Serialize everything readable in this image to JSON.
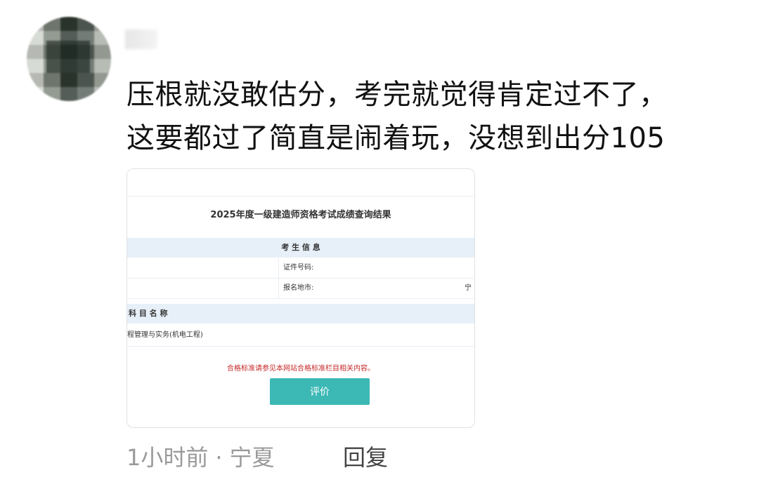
{
  "comment": {
    "line1": "压根就没敢估分，考完就觉得肯定过不了，",
    "line2": "这要都过了简直是闹着玩，没想到出分105"
  },
  "card": {
    "title": "2025年度一级建造师资格考试成绩查询结果",
    "section_title": "考  生  信  息",
    "id_label": "证件号码:",
    "region_label": "报名地市:",
    "region_value": "宁",
    "subject_header": "科  目  名  称",
    "subject_name": "程管理与实务(机电工程)",
    "notice": "合格标准请参见本网站合格标准栏目相关内容。",
    "button_label": "评价"
  },
  "meta": {
    "time": "1小时前",
    "separator": "·",
    "location": "宁夏",
    "reply": "回复"
  }
}
